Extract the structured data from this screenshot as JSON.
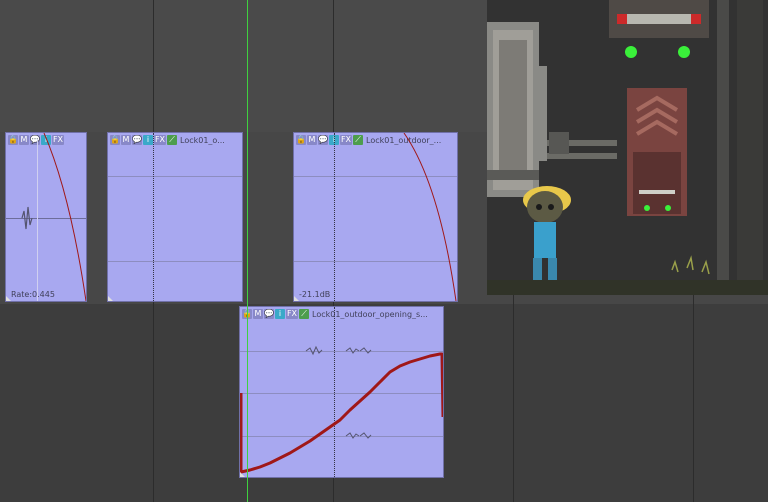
{
  "clips": [
    {
      "id": "clip-a",
      "name": "",
      "label": "Rate:0.445"
    },
    {
      "id": "clip-b",
      "name": "Lock01_o...",
      "label": ""
    },
    {
      "id": "clip-c",
      "name": "Lock01_outdoor_...",
      "label": "-21.1dB"
    },
    {
      "id": "clip-d",
      "name": "Lock01_outdoor_opening_s...",
      "label": ""
    }
  ],
  "clip_buttons": {
    "lock": "🔒",
    "mute": "M",
    "comment": "💬",
    "info": "i",
    "fx": "FX",
    "envelope": "⟋"
  },
  "colors": {
    "clip_fill": "#a8a8f0",
    "envelope": "#a01818",
    "playhead": "#3fd13f",
    "track_bg": "#474747"
  },
  "game_preview": {
    "icons": [
      "industrial-door",
      "generator-machine",
      "green-lights",
      "blonde-character"
    ]
  }
}
